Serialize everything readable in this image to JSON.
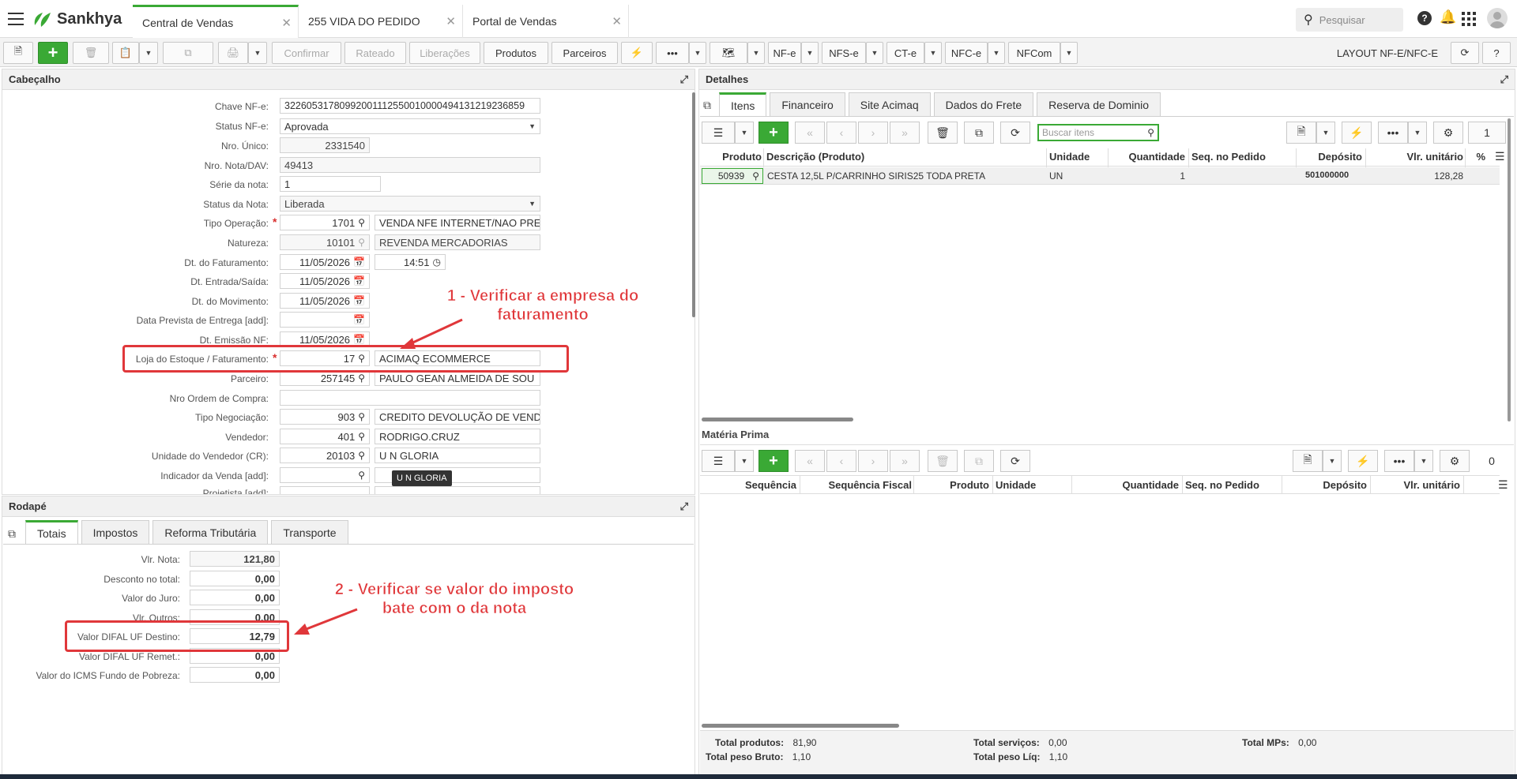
{
  "app": {
    "brand": "Sankhya",
    "brand_color": "#3aa935"
  },
  "tabs": [
    {
      "label": "Central de Vendas"
    },
    {
      "label": "255 VIDA DO PEDIDO"
    },
    {
      "label": "Portal de Vendas"
    }
  ],
  "search": {
    "placeholder": "Pesquisar"
  },
  "toolbar": {
    "confirmar": "Confirmar",
    "rateado": "Rateado",
    "liberacoes": "Liberações",
    "produtos": "Produtos",
    "parceiros": "Parceiros",
    "nfe": "NF-e",
    "nfse": "NFS-e",
    "cte": "CT-e",
    "nfce": "NFC-e",
    "nfcom": "NFCom",
    "layout": "LAYOUT NF-E/NFC-E"
  },
  "cabecalho": {
    "title": "Cabeçalho",
    "fields": {
      "chave_label": "Chave NF-e:",
      "chave": "32260531780992001112550010000494131219236859",
      "status_nfe_label": "Status NF-e:",
      "status_nfe": "Aprovada",
      "nro_unico_label": "Nro. Único:",
      "nro_unico": "2331540",
      "nro_nota_label": "Nro. Nota/DAV:",
      "nro_nota": "49413",
      "serie_label": "Série da nota:",
      "serie": "1",
      "status_nota_label": "Status da Nota:",
      "status_nota": "Liberada",
      "tipo_operacao_label": "Tipo Operação:",
      "tipo_operacao_cod": "1701",
      "tipo_operacao_desc": "VENDA NFE INTERNET/NAO PRE",
      "natureza_label": "Natureza:",
      "natureza_cod": "10101",
      "natureza_desc": "REVENDA MERCADORIAS",
      "dt_fat_label": "Dt. do Faturamento:",
      "dt_fat": "11/05/2026",
      "hora_fat": "14:51",
      "dt_es_label": "Dt. Entrada/Saída:",
      "dt_es": "11/05/2026",
      "dt_mov_label": "Dt. do Movimento:",
      "dt_mov": "11/05/2026",
      "data_prev_label": "Data Prevista de Entrega [add]:",
      "data_prev": "",
      "dt_emissao_label": "Dt. Emissão NF:",
      "dt_emissao": "11/05/2026",
      "loja_label": "Loja do Estoque / Faturamento:",
      "loja_cod": "17",
      "loja_desc": "ACIMAQ ECOMMERCE",
      "parceiro_label": "Parceiro:",
      "parceiro_cod": "257145",
      "parceiro_desc": "PAULO GEAN ALMEIDA DE SOU",
      "nro_ordem_label": "Nro Ordem de Compra:",
      "nro_ordem": "",
      "tipo_neg_label": "Tipo Negociação:",
      "tipo_neg_cod": "903",
      "tipo_neg_desc": "CREDITO DEVOLUÇÃO DE VEND",
      "vendedor_label": "Vendedor:",
      "vendedor_cod": "401",
      "vendedor_desc": "RODRIGO.CRUZ",
      "unidade_label": "Unidade do Vendedor (CR):",
      "unidade_cod": "20103",
      "unidade_desc": "U N GLORIA",
      "indicador_label": "Indicador da Venda [add]:",
      "indicador": "",
      "projetista_label": "Projetista [add]:",
      "tooltip": "U N GLORIA"
    },
    "annotation": "1 - Verificar a empresa do faturamento"
  },
  "rodape": {
    "title": "Rodapé",
    "tabs": [
      "Totais",
      "Impostos",
      "Reforma Tributária",
      "Transporte"
    ],
    "fields": {
      "vlr_nota_label": "Vlr. Nota:",
      "vlr_nota": "121,80",
      "desconto_label": "Desconto no total:",
      "desconto": "0,00",
      "juro_label": "Valor do Juro:",
      "juro": "0,00",
      "outros_label": "Vlr. Outros:",
      "outros": "0,00",
      "difal_dest_label": "Valor DIFAL UF Destino:",
      "difal_dest": "12,79",
      "difal_rem_label": "Valor DIFAL UF Remet.:",
      "difal_rem": "0,00",
      "icms_fp_label": "Valor do ICMS Fundo de Pobreza:",
      "icms_fp": "0,00"
    },
    "annotation": "2 - Verificar se valor do imposto bate com o da nota"
  },
  "detalhes": {
    "title": "Detalhes",
    "tabs": [
      "Itens",
      "Financeiro",
      "Site Acimaq",
      "Dados do Frete",
      "Reserva de Dominio"
    ],
    "search_placeholder": "Buscar itens",
    "page": "1",
    "columns": [
      "Produto",
      "Descrição (Produto)",
      "Unidade",
      "Quantidade",
      "Seq. no Pedido",
      "Depósito",
      "Vlr. unitário",
      "%"
    ],
    "rows": [
      {
        "produto": "50939",
        "descricao": "CESTA 12,5L P/CARRINHO SIRIS25 TODA PRETA",
        "unidade": "UN",
        "quantidade": "1",
        "seq": "",
        "deposito": "501000000",
        "vlr_unit": "128,28"
      }
    ]
  },
  "materia_prima": {
    "title": "Matéria Prima",
    "page": "0",
    "columns": [
      "Sequência",
      "Sequência Fiscal",
      "Produto",
      "Unidade",
      "Quantidade",
      "Seq. no Pedido",
      "Depósito",
      "Vlr. unitário"
    ]
  },
  "totais": {
    "produtos_label": "Total produtos:",
    "produtos": "81,90",
    "servicos_label": "Total serviços:",
    "servicos": "0,00",
    "mps_label": "Total MPs:",
    "mps": "0,00",
    "peso_bruto_label": "Total peso Bruto:",
    "peso_bruto": "1,10",
    "peso_liq_label": "Total peso Líq:",
    "peso_liq": "1,10"
  }
}
